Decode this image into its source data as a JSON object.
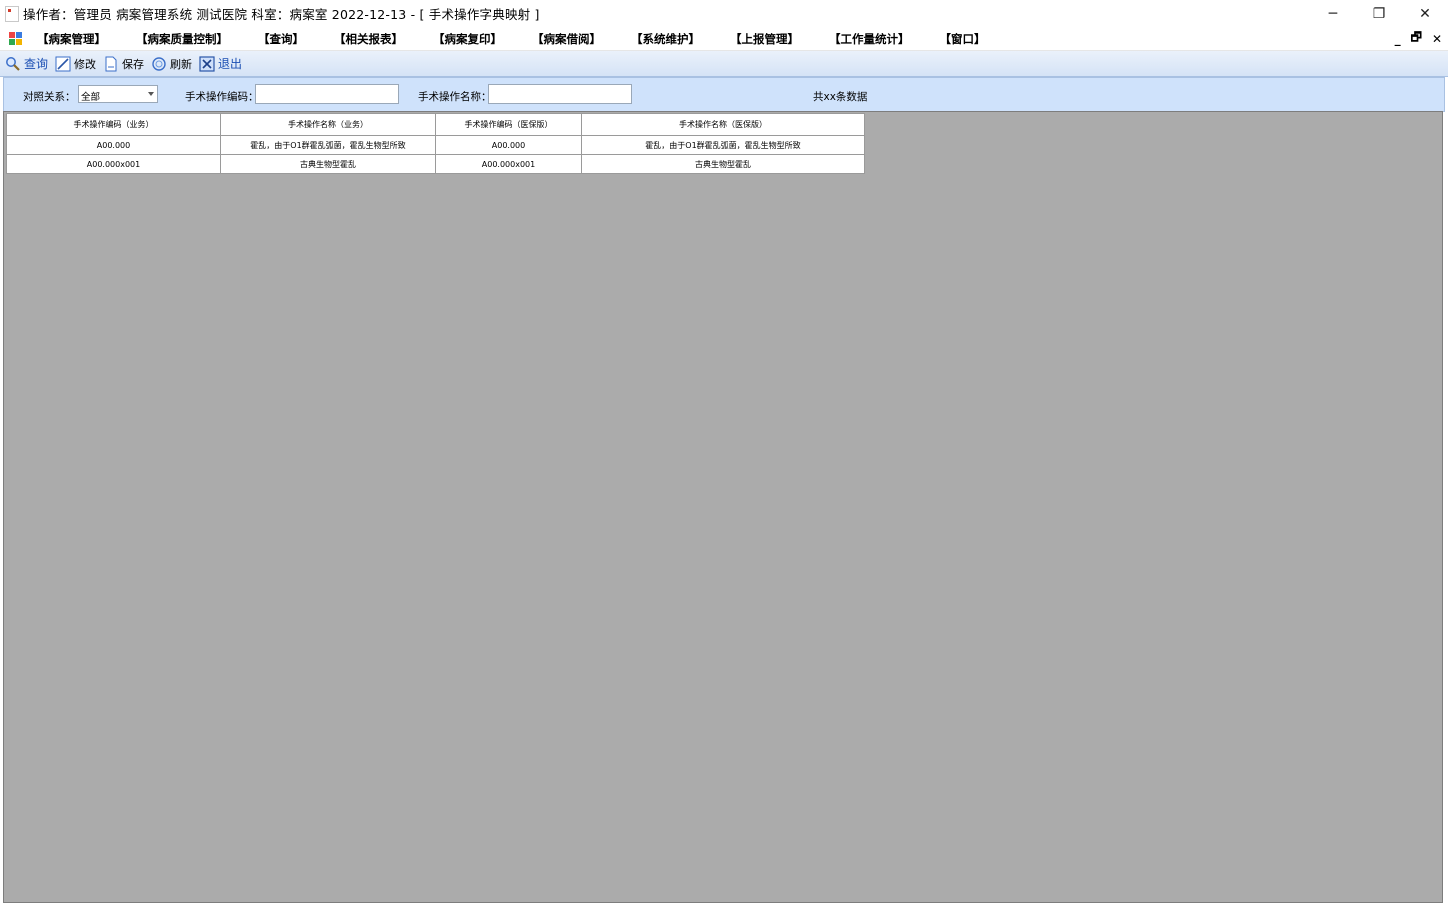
{
  "window": {
    "title": "操作者：管理员  病案管理系统  测试医院  科室：病案室  2022-12-13 - [   手术操作字典映射   ]",
    "minimize": "─",
    "restore": "❐",
    "close": "✕"
  },
  "menu": {
    "items": [
      "【病案管理】",
      "【病案质量控制】",
      "【查询】",
      "【相关报表】",
      "【病案复印】",
      "【病案借阅】",
      "【系统维护】",
      "【上报管理】",
      "【工作量统计】",
      "【窗口】"
    ],
    "mdi_minimize": "_",
    "mdi_restore": "🗗",
    "mdi_close": "✕"
  },
  "toolbar": {
    "query": "查询",
    "edit": "修改",
    "save": "保存",
    "refresh": "刷新",
    "exit": "退出"
  },
  "filter": {
    "relation_label": "对照关系：",
    "relation_value": "全部",
    "code_label": "手术操作编码：",
    "code_value": "",
    "name_label": "手术操作名称：",
    "name_value": "",
    "count_text": "共xx条数据"
  },
  "grid": {
    "columns": [
      "手术操作编码（业务）",
      "手术操作名称（业务）",
      "手术操作编码（医保版）",
      "手术操作名称（医保版）"
    ],
    "rows": [
      [
        "A00.000",
        "霍乱，由于O1群霍乱弧菌，霍乱生物型所致",
        "A00.000",
        "霍乱，由于O1群霍乱弧菌，霍乱生物型所致"
      ],
      [
        "A00.000x001",
        "古典生物型霍乱",
        "A00.000x001",
        "古典生物型霍乱"
      ]
    ]
  },
  "colors": {
    "toolbar_bg": "#d5e3f6",
    "filter_bg": "#cfe2fb",
    "mdi_bg": "#ababab",
    "toolbar_link": "#1b4fb3"
  }
}
